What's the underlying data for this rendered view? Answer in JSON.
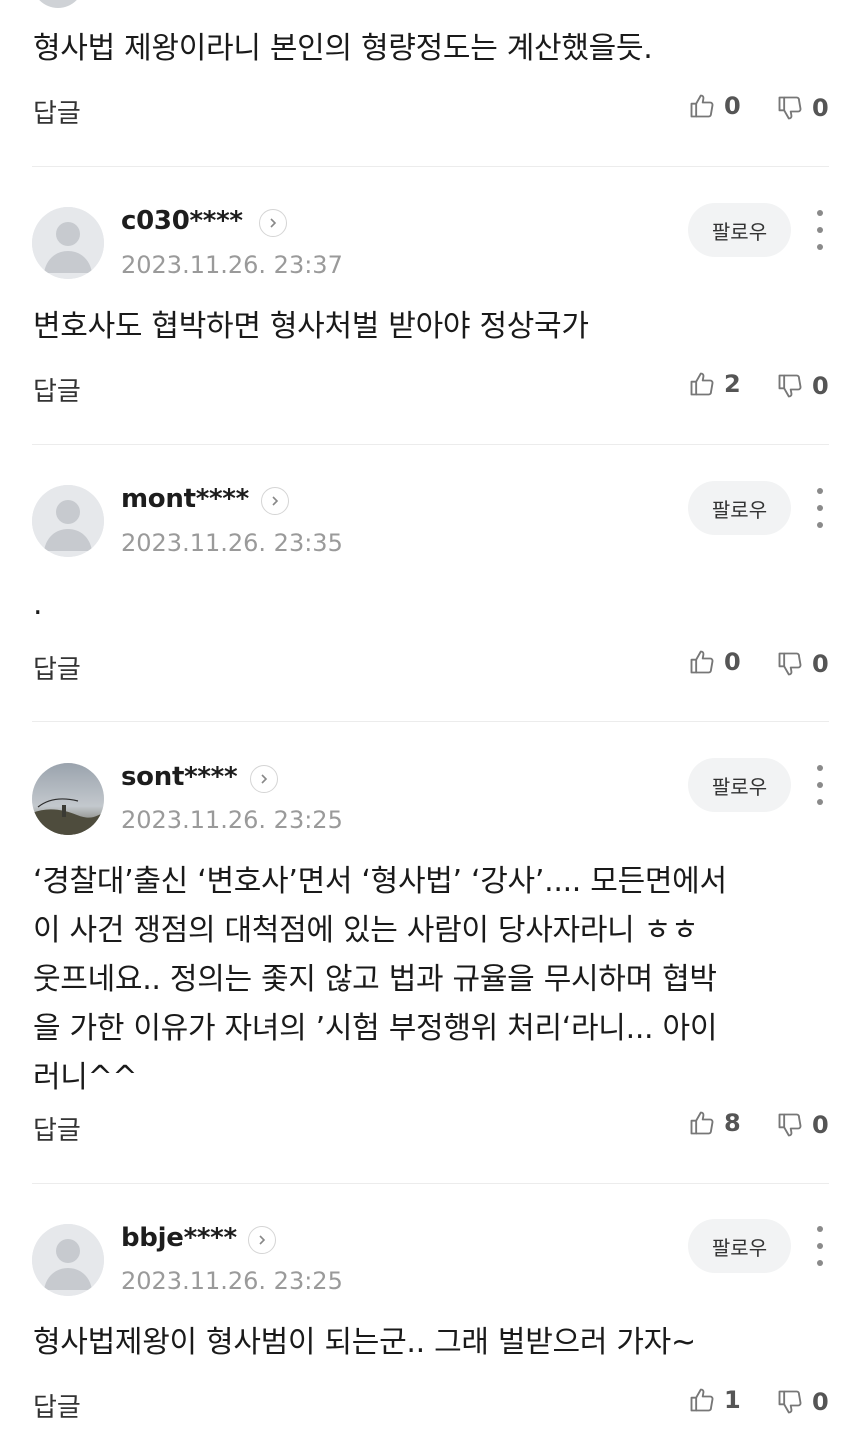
{
  "comments": [
    {
      "body": "형사법 제왕이라니 본인의 형량정도는 계산했을듯.",
      "reply_label": "답글",
      "likes": "0",
      "dislikes": "0"
    },
    {
      "username": "c030****",
      "datetime": "2023.11.26. 23:37",
      "follow_label": "팔로우",
      "body": "변호사도 협박하면 형사처벌 받아야 정상국가",
      "reply_label": "답글",
      "likes": "2",
      "dislikes": "0"
    },
    {
      "username": "mont****",
      "datetime": "2023.11.26. 23:35",
      "follow_label": "팔로우",
      "body": ".",
      "reply_label": "답글",
      "likes": "0",
      "dislikes": "0"
    },
    {
      "username": "sont****",
      "datetime": "2023.11.26. 23:25",
      "follow_label": "팔로우",
      "body": "‘경찰대’출신 ‘변호사’면서 ‘형사법’ ‘강사’.... 모든면에서\n이 사건 쟁점의 대척점에 있는 사람이 당사자라니 ㅎㅎ\n웃프네요.. 정의는 좇지 않고 법과 규율을 무시하며 협박\n을 가한 이유가 자녀의 ’시험 부정행위 처리‘라니... 아이\n러니^^",
      "reply_label": "답글",
      "likes": "8",
      "dislikes": "0"
    },
    {
      "username": "bbje****",
      "datetime": "2023.11.26. 23:25",
      "follow_label": "팔로우",
      "body": "형사법제왕이 형사범이 되는군.. 그래 벌받으러 가자~",
      "reply_label": "답글",
      "likes": "1",
      "dislikes": "0"
    }
  ]
}
